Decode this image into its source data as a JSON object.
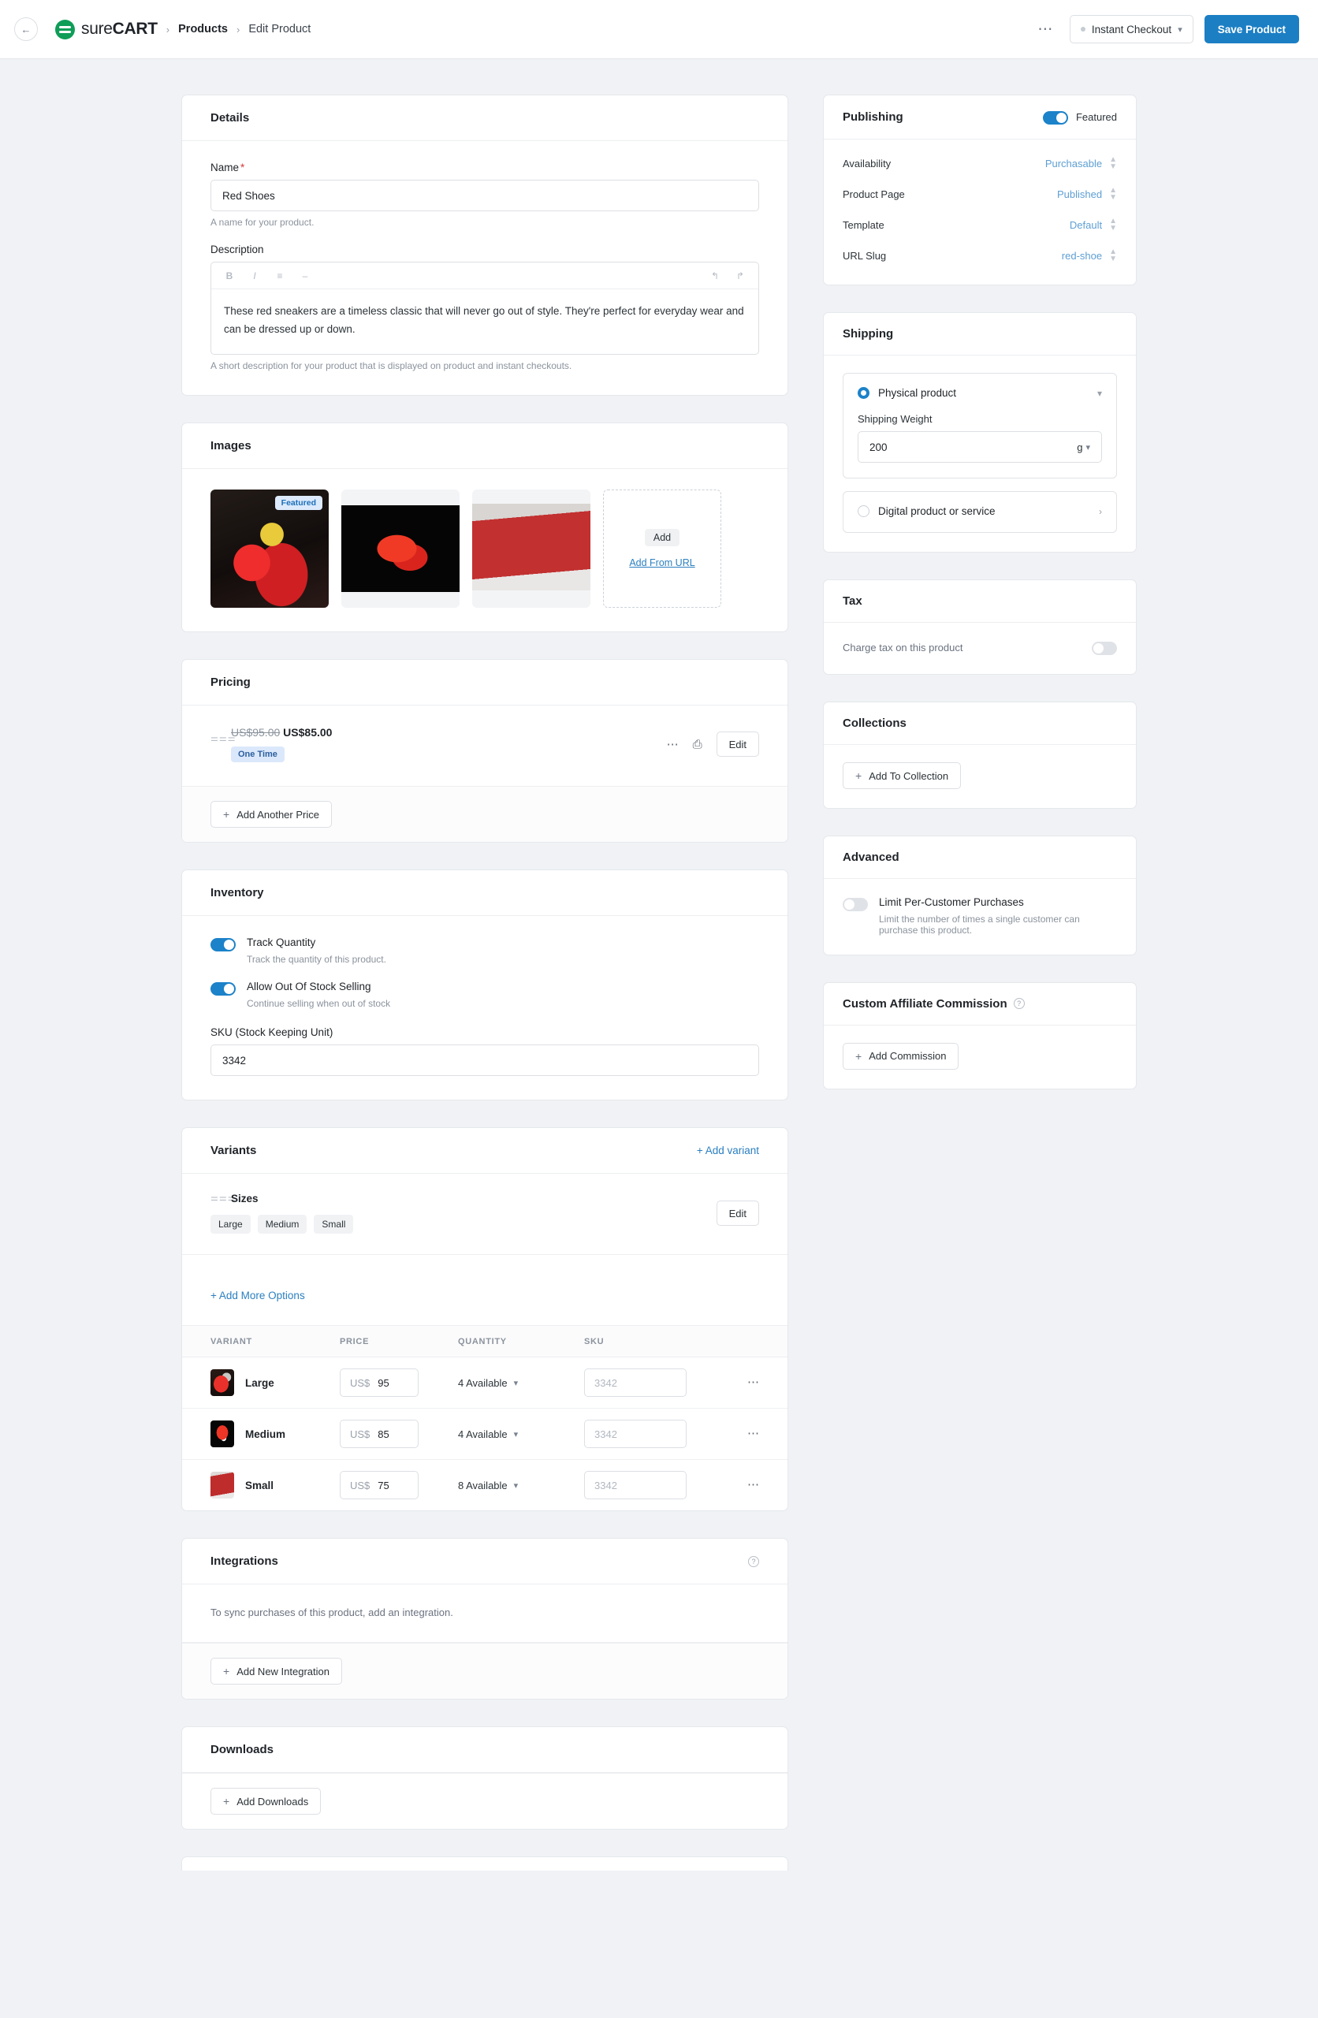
{
  "topbar": {
    "back_icon": "back-arrow-icon",
    "brand_sure": "sure",
    "brand_cart": "CART",
    "breadcrumb": [
      "Products",
      "Edit Product"
    ],
    "more_icon": "ellipsis-icon",
    "instant_checkout_label": "Instant Checkout",
    "save_label": "Save Product"
  },
  "details": {
    "title": "Details",
    "name_label": "Name",
    "name_value": "Red Shoes",
    "name_help": "A name for your product.",
    "description_label": "Description",
    "toolbar": [
      "bold-icon",
      "italic-icon",
      "list-icon",
      "link-icon",
      "undo-icon",
      "redo-icon"
    ],
    "description_value": "These red sneakers are a timeless classic that will never go out of style. They're perfect for everyday wear and can be dressed up or down.",
    "description_help": "A short description for your product that is displayed on product and instant checkouts."
  },
  "images": {
    "title": "Images",
    "featured_badge": "Featured",
    "add_label": "Add",
    "add_from_url_label": "Add From URL"
  },
  "pricing": {
    "title": "Pricing",
    "old_price": "US$95.00",
    "new_price": "US$85.00",
    "type_badge": "One Time",
    "more_icon": "ellipsis-icon",
    "duplicate_icon": "duplicate-icon",
    "edit_label": "Edit",
    "add_another_label": "Add Another Price"
  },
  "inventory": {
    "title": "Inventory",
    "track_quantity_label": "Track Quantity",
    "track_quantity_desc": "Track the quantity of this product.",
    "track_quantity_on": true,
    "allow_oos_label": "Allow Out Of Stock Selling",
    "allow_oos_desc": "Continue selling when out of stock",
    "allow_oos_on": true,
    "sku_label": "SKU (Stock Keeping Unit)",
    "sku_value": "3342"
  },
  "variants": {
    "title": "Variants",
    "add_variant_label": "+ Add variant",
    "group_name": "Sizes",
    "group_values": [
      "Large",
      "Medium",
      "Small"
    ],
    "group_edit_label": "Edit",
    "add_more_options_label": "+ Add More Options",
    "columns": [
      "VARIANT",
      "PRICE",
      "QUANTITY",
      "SKU"
    ],
    "rows": [
      {
        "name": "Large",
        "currency": "US$",
        "price": "95",
        "quantity": "4 Available",
        "sku_placeholder": "3342"
      },
      {
        "name": "Medium",
        "currency": "US$",
        "price": "85",
        "quantity": "4 Available",
        "sku_placeholder": "3342"
      },
      {
        "name": "Small",
        "currency": "US$",
        "price": "75",
        "quantity": "8 Available",
        "sku_placeholder": "3342"
      }
    ]
  },
  "integrations": {
    "title": "Integrations",
    "help_icon": "question-mark-icon",
    "empty_text": "To sync purchases of this product, add an integration.",
    "add_label": "Add New Integration"
  },
  "downloads": {
    "title": "Downloads",
    "add_label": "Add Downloads"
  },
  "publishing": {
    "title": "Publishing",
    "featured_label": "Featured",
    "featured_on": true,
    "rows": [
      {
        "key": "Availability",
        "value": "Purchasable"
      },
      {
        "key": "Product Page",
        "value": "Published"
      },
      {
        "key": "Template",
        "value": "Default"
      },
      {
        "key": "URL Slug",
        "value": "red-shoe"
      }
    ]
  },
  "shipping": {
    "title": "Shipping",
    "physical_label": "Physical product",
    "physical_selected": true,
    "weight_label": "Shipping Weight",
    "weight_value": "200",
    "weight_unit": "g",
    "digital_label": "Digital product or service",
    "digital_selected": false
  },
  "tax": {
    "title": "Tax",
    "charge_label": "Charge tax on this product",
    "charge_on": false
  },
  "collections": {
    "title": "Collections",
    "add_label": "Add To Collection"
  },
  "advanced": {
    "title": "Advanced",
    "limit_label": "Limit Per-Customer Purchases",
    "limit_desc": "Limit the number of times a single customer can purchase this product.",
    "limit_on": false
  },
  "affiliate": {
    "title": "Custom Affiliate Commission",
    "help_icon": "question-mark-icon",
    "add_label": "Add Commission"
  },
  "colors": {
    "accent": "#1c7fc4",
    "link": "#2b7fc0",
    "brand_green": "#0f9d58",
    "toggle_on": "#1c82c9",
    "required": "#d63638"
  }
}
